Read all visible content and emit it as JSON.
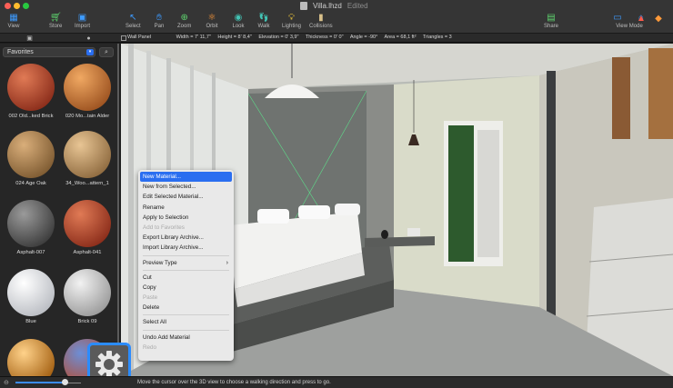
{
  "window": {
    "title": "Villa.lhzd",
    "status": "Edited"
  },
  "toolbar": {
    "view": "View",
    "store": "Store",
    "import": "Import",
    "select": "Select",
    "pan": "Pan",
    "zoom": "Zoom",
    "orbit": "Orbit",
    "look": "Look",
    "walk": "Walk",
    "lighting": "Lighting",
    "collisions": "Collisions",
    "share": "Share",
    "view_mode": "View Mode"
  },
  "infobar": {
    "object": "Wall Panel",
    "width": "Width = 7' 11,7\"",
    "height": "Height = 8' 8,4\"",
    "elevation": "Elevation = 0' 3,9\"",
    "thickness": "Thickness = 0' 0\"",
    "angle": "Angle = -90°",
    "area": "Area = 68,1 ft²",
    "triangles": "Triangles = 3"
  },
  "sidebar": {
    "collection": "Favorites",
    "materials": [
      {
        "label": "002 Old...ked Brick",
        "color_a": "#e07a55",
        "color_b": "#8a2c1a"
      },
      {
        "label": "020 Mo...tain Alder",
        "color_a": "#f0a862",
        "color_b": "#9c5220"
      },
      {
        "label": "024 Age Oak",
        "color_a": "#d9ae7a",
        "color_b": "#7d5a31"
      },
      {
        "label": "34_Woo...attern_1",
        "color_a": "#e8c594",
        "color_b": "#8e6a3f"
      },
      {
        "label": "Asphalt-007",
        "color_a": "#9a9a9a",
        "color_b": "#3b3b3b"
      },
      {
        "label": "Asphalt-041",
        "color_a": "#e07a55",
        "color_b": "#8a2c1a"
      },
      {
        "label": "Blue",
        "color_a": "#ffffff",
        "color_b": "#b9bcc2"
      },
      {
        "label": "Brick 09",
        "color_a": "#f2f2f2",
        "color_b": "#9a9a9a"
      },
      {
        "label": "",
        "color_a": "#ffd28a",
        "color_b": "#a25e10"
      },
      {
        "label": "",
        "color_a": "#6c8ed6",
        "color_b": "#b84a2a"
      }
    ]
  },
  "context_menu": {
    "items": [
      {
        "label": "New Material...",
        "state": "selected"
      },
      {
        "label": "New from Selected...",
        "state": "enabled"
      },
      {
        "label": "Edit Selected Material...",
        "state": "enabled"
      },
      {
        "label": "Rename",
        "state": "enabled"
      },
      {
        "label": "Apply to Selection",
        "state": "enabled"
      },
      {
        "label": "Add to Favorites",
        "state": "disabled"
      },
      {
        "label": "Export Library Archive...",
        "state": "enabled"
      },
      {
        "label": "Import Library Archive...",
        "state": "enabled"
      },
      {
        "label": "Preview Type",
        "state": "submenu"
      },
      {
        "label": "Cut",
        "state": "enabled"
      },
      {
        "label": "Copy",
        "state": "enabled"
      },
      {
        "label": "Paste",
        "state": "disabled"
      },
      {
        "label": "Delete",
        "state": "enabled"
      },
      {
        "label": "Select All",
        "state": "enabled"
      },
      {
        "label": "Undo Add Material",
        "state": "enabled"
      },
      {
        "label": "Redo",
        "state": "disabled"
      }
    ]
  },
  "status": {
    "message": "Move the cursor over the 3D view to choose a walking direction and press to go.",
    "thumbnail_size": 0.75
  },
  "colors": {
    "accent": "#2a6ef0",
    "highlight_ring": "#2b8cff"
  }
}
